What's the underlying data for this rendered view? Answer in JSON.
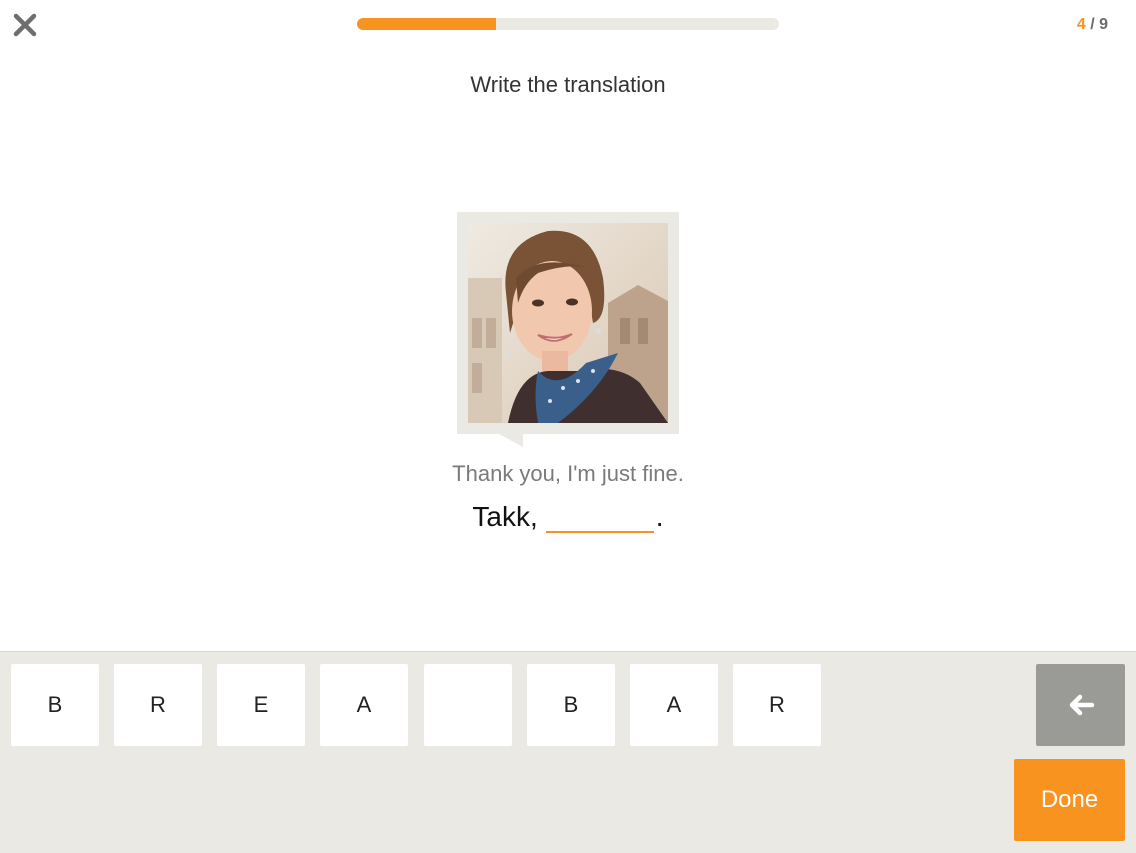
{
  "header": {
    "progress": 0.33,
    "counter_current": "4",
    "counter_sep": " / ",
    "counter_total": "9",
    "close_icon": "close-icon"
  },
  "exercise": {
    "instruction": "Write the translation",
    "phrase": "Thank you, I'm just fine.",
    "answer_prefix": "Takk,",
    "answer_suffix": ".",
    "image_icon": "portrait-photo"
  },
  "keyboard": {
    "keys": [
      {
        "label": "B"
      },
      {
        "label": "R"
      },
      {
        "label": "E"
      },
      {
        "label": "A"
      },
      {
        "label": ""
      },
      {
        "label": "B"
      },
      {
        "label": "A"
      },
      {
        "label": "R"
      }
    ],
    "backspace_icon": "backspace-arrow-icon",
    "done_label": "Done"
  },
  "colors": {
    "accent": "#f7931e",
    "panel": "#ebe9e3",
    "backspace": "#9a9a96"
  }
}
